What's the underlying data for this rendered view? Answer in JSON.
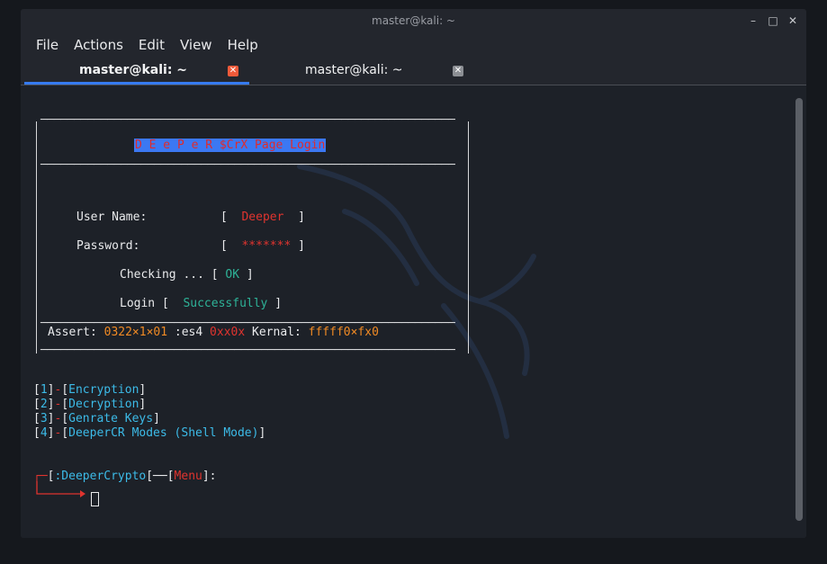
{
  "window": {
    "title": "master@kali: ~",
    "minimize_glyph": "–",
    "maximize_glyph": "□",
    "close_glyph": "✕"
  },
  "menu": [
    "File",
    "Actions",
    "Edit",
    "View",
    "Help"
  ],
  "tabs": [
    {
      "label": "master@kali: ~",
      "active": true,
      "close_color": "#f05a3a"
    },
    {
      "label": "master@kali: ~",
      "active": false,
      "close_color": "#8c8f94"
    }
  ],
  "terminal": {
    "banner_title": "D E e P e R $CrX Page Login",
    "username_label": "User Name:",
    "username_value": "Deeper",
    "password_label": "Password:",
    "password_value": "*******",
    "checking_label": "Checking ...",
    "checking_value": "OK",
    "login_label": "Login",
    "login_value": "Successfully",
    "assert_label": "Assert:",
    "assert_value": "0322×1×01",
    "es_label": ":es4",
    "es_value": "0xx0x",
    "kernal_label": "Kernal:",
    "kernal_value": "fffff0×fx0",
    "menu_options": [
      {
        "num": "1",
        "label": "Encryption"
      },
      {
        "num": "2",
        "label": "Decryption"
      },
      {
        "num": "3",
        "label": "Genrate Keys"
      },
      {
        "num": "4",
        "label": "DeeperCR Modes (Shell Mode)"
      }
    ],
    "prompt_name": ":DeeperCrypto",
    "prompt_section": "Menu"
  },
  "colors": {
    "accent": "#367bf0",
    "red": "#e0342f",
    "green": "#2eb398",
    "orange": "#f08a24",
    "blue": "#3cbbe8",
    "terminal_bg": "#1d2128"
  }
}
